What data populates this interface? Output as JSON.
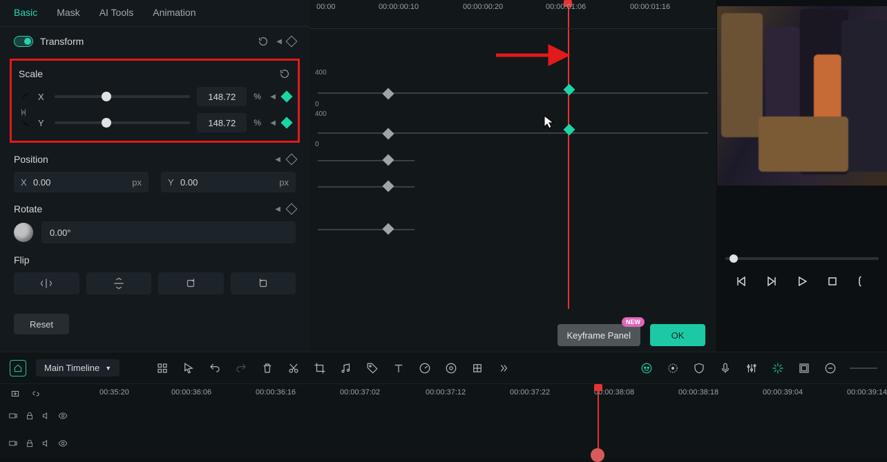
{
  "tabs": {
    "basic": "Basic",
    "mask": "Mask",
    "ai": "AI Tools",
    "anim": "Animation"
  },
  "transform": {
    "title": "Transform"
  },
  "scale": {
    "title": "Scale",
    "x_label": "X",
    "x_value": "148.72",
    "x_unit": "%",
    "y_label": "Y",
    "y_value": "148.72",
    "y_unit": "%"
  },
  "position": {
    "title": "Position",
    "x_label": "X",
    "x_value": "0.00",
    "x_unit": "px",
    "y_label": "Y",
    "y_value": "0.00",
    "y_unit": "px"
  },
  "rotate": {
    "title": "Rotate",
    "value": "0.00°"
  },
  "flip": {
    "title": "Flip"
  },
  "buttons": {
    "reset": "Reset",
    "kf_panel": "Keyframe Panel",
    "ok": "OK",
    "new": "NEW"
  },
  "keyframe_ruler": {
    "t0": "00:00",
    "t1": "00:00:00:10",
    "t2": "00:00:00:20",
    "t3": "00:00:01:06",
    "t4": "00:00:01:16",
    "y400a": "400",
    "y0a": "0",
    "y400b": "400",
    "y0b": "0"
  },
  "bottombar": {
    "timeline_name": "Main Timeline"
  },
  "bottom_ruler": {
    "t0": "00:35:20",
    "t1": "00:00:36:06",
    "t2": "00:00:36:16",
    "t3": "00:00:37:02",
    "t4": "00:00:37:12",
    "t5": "00:00:37:22",
    "t6": "00:00:38:08",
    "t7": "00:00:38:18",
    "t8": "00:00:39:04",
    "t9": "00:00:39:14"
  },
  "colors": {
    "accent": "#1cc9a4",
    "highlight": "#e21a1a"
  }
}
